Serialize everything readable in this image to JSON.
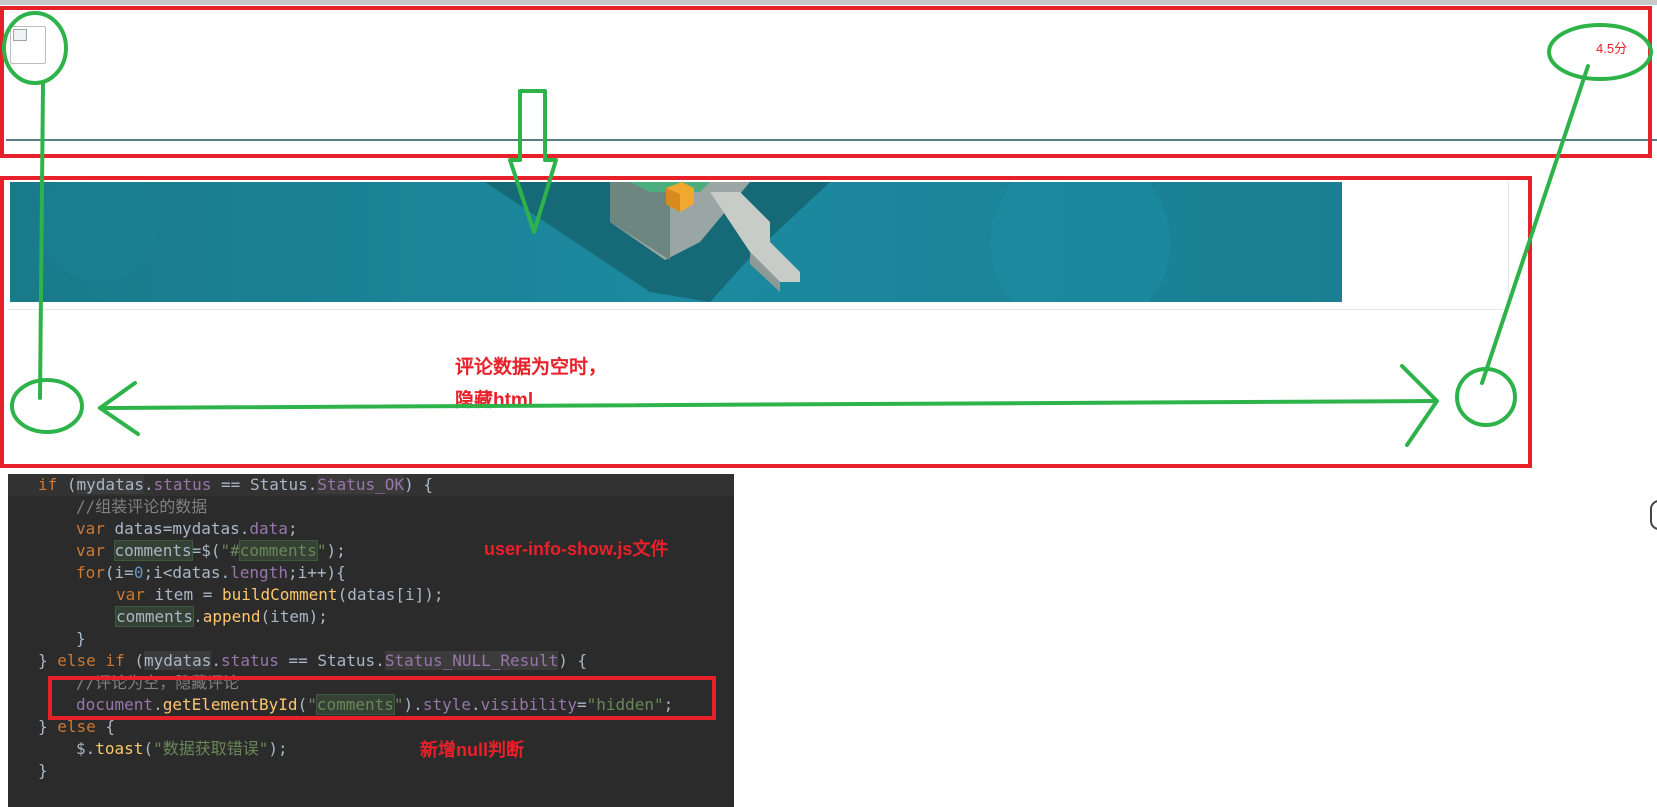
{
  "header": {
    "rating_text": "4.5分",
    "avatar_label": "user avatar (broken image)"
  },
  "annotations": {
    "empty_note_line1": "评论数据为空时，",
    "empty_note_line2": "隐藏html",
    "file_note": "user-info-show.js文件",
    "null_note": "新增null判断"
  },
  "colors": {
    "annotation_red": "#e8202a",
    "annotation_green": "#2db34a",
    "editor_bg": "#2b2b2b"
  },
  "code": {
    "language": "javascript",
    "lines": [
      "if (mydatas.status == Status.Status_OK) {",
      "    //组装评论的数据",
      "    var datas=mydatas.data;",
      "    var comments=$(\"#comments\");",
      "    for(i=0;i<datas.length;i++){",
      "        var item = buildComment(datas[i]);",
      "        comments.append(item);",
      "    }",
      "} else if (mydatas.status == Status.Status_NULL_Result) {",
      "    //评论为空，隐藏评论",
      "    document.getElementById(\"comments\").style.visibility=\"hidden\";",
      "} else {",
      "    $.toast(\"数据获取错误\");",
      "}"
    ]
  },
  "icons": [
    "broken-image-icon",
    "down-arrow-icon",
    "double-headed-arrow-icon",
    "edge-toggle-icon"
  ]
}
